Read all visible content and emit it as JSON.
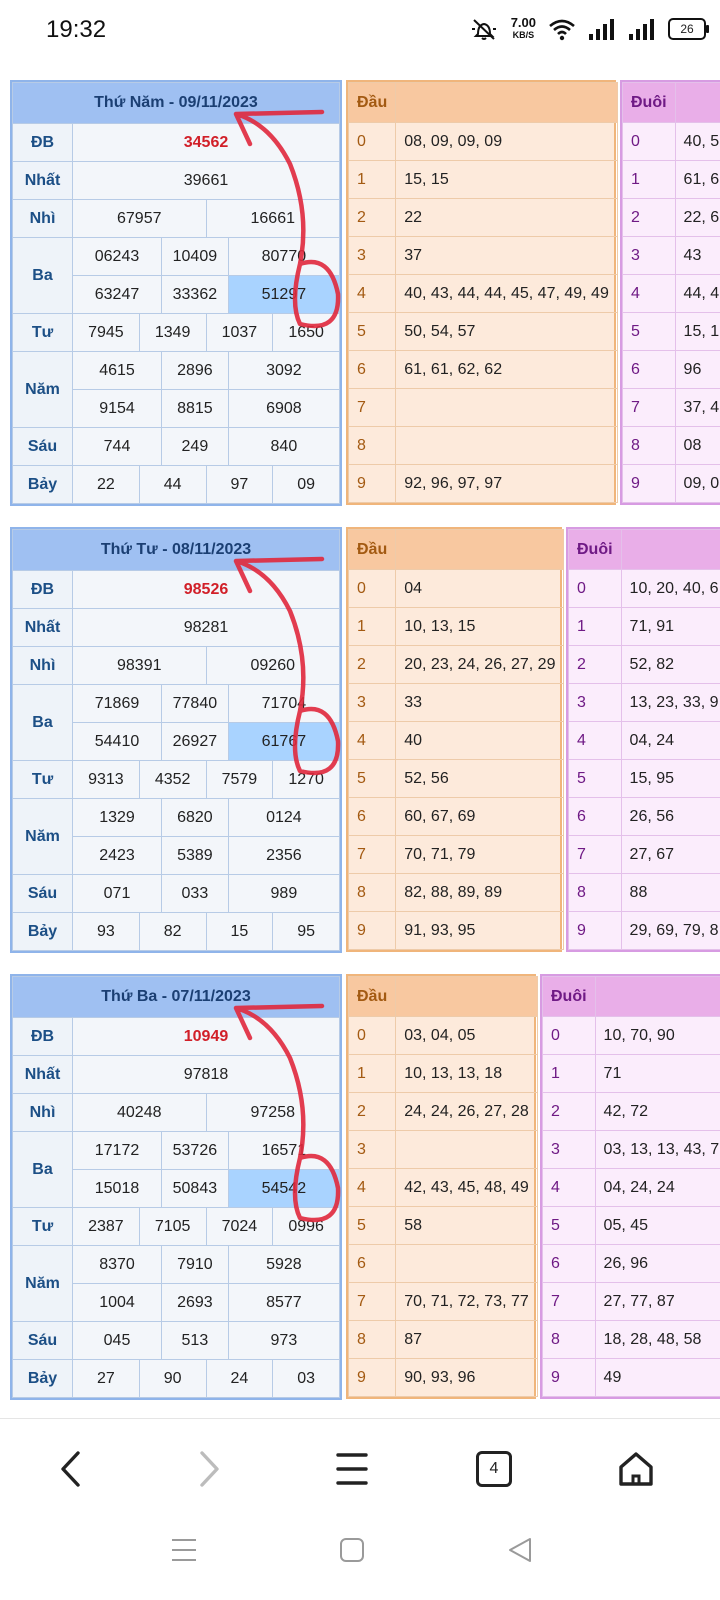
{
  "status": {
    "time": "19:32",
    "speed": "7.00",
    "speed_unit": "KB/S",
    "battery": "26"
  },
  "labels": {
    "db": "ĐB",
    "nhat": "Nhất",
    "nhi": "Nhì",
    "ba": "Ba",
    "tu": "Tư",
    "nam": "Năm",
    "sau": "Sáu",
    "bay": "Bảy",
    "dau": "Đầu",
    "duoi": "Đuôi"
  },
  "days": [
    {
      "title": "Thứ Năm - 09/11/2023",
      "db": "34562",
      "nhat": "39661",
      "nhi": [
        "67957",
        "16661"
      ],
      "ba1": [
        "06243",
        "10409",
        "80770"
      ],
      "ba2": [
        "63247",
        "33362",
        "51297"
      ],
      "tu": [
        "7945",
        "1349",
        "1037",
        "1650"
      ],
      "nam1": [
        "4615",
        "2896",
        "3092"
      ],
      "nam2": [
        "9154",
        "8815",
        "6908"
      ],
      "sau": [
        "744",
        "249",
        "840"
      ],
      "bay": [
        "22",
        "44",
        "97",
        "09"
      ],
      "dau": [
        "08, 09, 09, 09",
        "15, 15",
        "22",
        "37",
        "40, 43, 44, 44, 45, 47, 49, 49",
        "50, 54, 57",
        "61, 61, 62, 62",
        "",
        "",
        "92, 96, 97, 97"
      ],
      "duoi": [
        "40, 5",
        "61, 6",
        "22, 6",
        "43",
        "44, 4",
        "15, 1",
        "96",
        "37, 4",
        "08",
        "09, 0"
      ]
    },
    {
      "title": "Thứ Tư - 08/11/2023",
      "db": "98526",
      "nhat": "98281",
      "nhi": [
        "98391",
        "09260"
      ],
      "ba1": [
        "71869",
        "77840",
        "71704"
      ],
      "ba2": [
        "54410",
        "26927",
        "61767"
      ],
      "tu": [
        "9313",
        "4352",
        "7579",
        "1270"
      ],
      "nam1": [
        "1329",
        "6820",
        "0124"
      ],
      "nam2": [
        "2423",
        "5389",
        "2356"
      ],
      "sau": [
        "071",
        "033",
        "989"
      ],
      "bay": [
        "93",
        "82",
        "15",
        "95"
      ],
      "dau": [
        "04",
        "10, 13, 15",
        "20, 23, 24, 26, 27, 29",
        "33",
        "40",
        "52, 56",
        "60, 67, 69",
        "70, 71, 79",
        "82, 88, 89, 89",
        "91, 93, 95"
      ],
      "duoi": [
        "10, 20, 40, 6",
        "71, 91",
        "52, 82",
        "13, 23, 33, 9",
        "04, 24",
        "15, 95",
        "26, 56",
        "27, 67",
        "88",
        "29, 69, 79, 8"
      ]
    },
    {
      "title": "Thứ Ba - 07/11/2023",
      "db": "10949",
      "nhat": "97818",
      "nhi": [
        "40248",
        "97258"
      ],
      "ba1": [
        "17172",
        "53726",
        "16571"
      ],
      "ba2": [
        "15018",
        "50843",
        "54542"
      ],
      "tu": [
        "2387",
        "7105",
        "7024",
        "0996"
      ],
      "nam1": [
        "8370",
        "7910",
        "5928"
      ],
      "nam2": [
        "1004",
        "2693",
        "8577"
      ],
      "sau": [
        "045",
        "513",
        "973"
      ],
      "bay": [
        "27",
        "90",
        "24",
        "03"
      ],
      "dau": [
        "03, 04, 05",
        "10, 13, 13, 18",
        "24, 24, 26, 27, 28",
        "",
        "42, 43, 45, 48, 49",
        "58",
        "",
        "70, 71, 72, 73, 77",
        "87",
        "90, 93, 96"
      ],
      "duoi": [
        "10, 70, 90",
        "71",
        "42, 72",
        "03, 13, 13, 43, 7",
        "04, 24, 24",
        "05, 45",
        "26, 96",
        "27, 77, 87",
        "18, 28, 48, 58",
        "49"
      ]
    }
  ],
  "browser_nav": {
    "tab_count": "4"
  }
}
